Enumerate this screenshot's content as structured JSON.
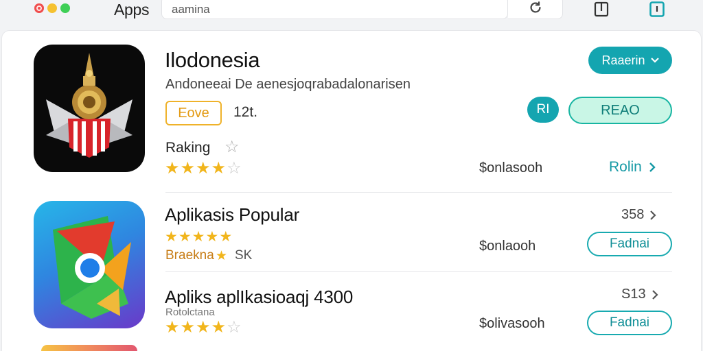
{
  "window": {
    "title": "Apps",
    "search_placeholder": "aamina"
  },
  "featured": {
    "name": "Ilodonesia",
    "subtitle": "Andoneeai De aenesjoqrabadalonarisen",
    "badge": "Eove",
    "count": "12t.",
    "ranking_label": "Raking",
    "rating": 4,
    "action_primary": "Raaerin",
    "action_round": "RI",
    "action_read": "REAO",
    "price": "$onlasooh",
    "more_link": "Rolin"
  },
  "sections": [
    {
      "title": "Aplikasis Popular",
      "rating": 4.5,
      "meta": "Braekna",
      "meta_count": "SK",
      "count": "358",
      "price": "$onlaooh",
      "button": "Fadnai"
    },
    {
      "title": "Apliks aplIkasioaqj 4300",
      "rating": 4,
      "meta": "Rotolctana",
      "count": "S13",
      "price": "$olivasooh",
      "button": "Fadnai"
    }
  ],
  "colors": {
    "accent": "#14a5b0",
    "star": "#f1b51c",
    "badge": "#efb22a"
  }
}
